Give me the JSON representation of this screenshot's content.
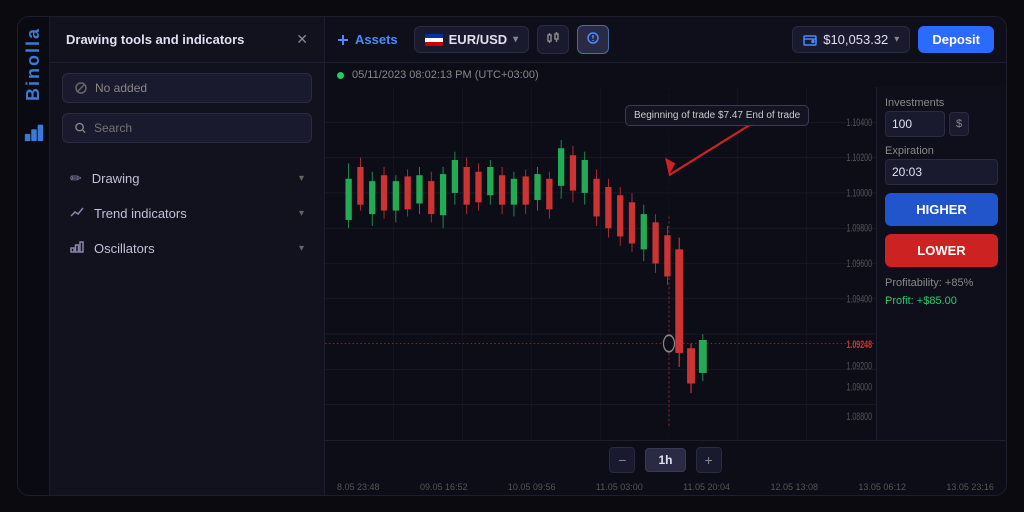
{
  "brand": {
    "name": "Binolla"
  },
  "tools_panel": {
    "title": "Drawing tools and indicators",
    "no_added_label": "No added",
    "search_placeholder": "Search",
    "sections": [
      {
        "id": "drawing",
        "label": "Drawing",
        "icon": "✏️"
      },
      {
        "id": "trend",
        "label": "Trend indicators",
        "icon": "📈"
      },
      {
        "id": "oscillators",
        "label": "Oscillators",
        "icon": "📊"
      }
    ]
  },
  "assets_panel": {
    "title": "Assets",
    "add_label": "Add"
  },
  "header": {
    "asset": "EUR/USD",
    "chart_icon_label": "chart-type",
    "indicator_icon_label": "indicators",
    "balance": "$10,053.32",
    "deposit_label": "Deposit"
  },
  "chart": {
    "timestamp": "05/11/2023 08:02:13 PM (UTC+03:00)",
    "live_dot_color": "#22cc66",
    "tooltip_text": "Beginning of trade $7.47 End of trade",
    "current_price": "1.09248",
    "price_level_color": "#cc3333",
    "timeframe": "1h",
    "x_labels": [
      "8.05 23:48",
      "09.05 16:52",
      "10.05 09:56",
      "11.05 03:00",
      "11.05 20:04",
      "12.05 13:08",
      "13.05 06:12",
      "13.05 23:16"
    ],
    "y_labels": [
      "1.10400",
      "1.10200",
      "1.10000",
      "1.09800",
      "1.09600",
      "1.09400",
      "1.09248",
      "1.09200",
      "1.09000",
      "1.08800"
    ]
  },
  "right_panel": {
    "investments_label": "Investments",
    "investment_value": "100",
    "currency": "$",
    "expiration_label": "Expiration",
    "expiration_value": "20:03",
    "higher_label": "HIGHER",
    "lower_label": "LOWER",
    "profitability_label": "Profitability: +85%",
    "profit_label": "Profit: +$85.00"
  }
}
